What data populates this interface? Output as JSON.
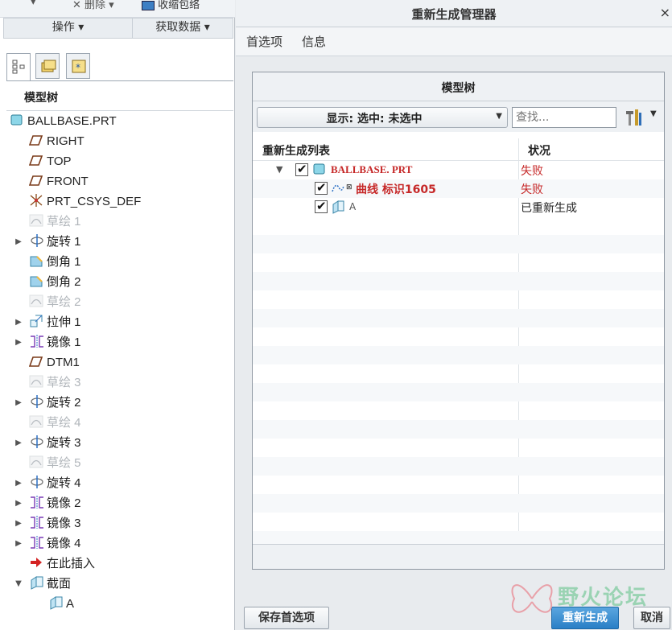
{
  "left_panel": {
    "ribbon_top": {
      "delete_label": "删除",
      "shrink_label": "收缩包络"
    },
    "groups": {
      "operations": "操作 ▾",
      "get_data": "获取数据 ▾"
    },
    "tabs": [
      "model-tree",
      "folder-browser",
      "favorites"
    ],
    "header": "模型树",
    "tree": [
      {
        "label": "BALLBASE.PRT",
        "icon": "part-icon",
        "dim": false,
        "expandable": false
      },
      {
        "label": "RIGHT",
        "icon": "datum-plane-icon",
        "dim": false,
        "expandable": false
      },
      {
        "label": "TOP",
        "icon": "datum-plane-icon",
        "dim": false,
        "expandable": false
      },
      {
        "label": "FRONT",
        "icon": "datum-plane-icon",
        "dim": false,
        "expandable": false
      },
      {
        "label": "PRT_CSYS_DEF",
        "icon": "csys-icon",
        "dim": false,
        "expandable": false
      },
      {
        "label": "草绘 1",
        "icon": "sketch-icon",
        "dim": true,
        "expandable": false
      },
      {
        "label": "旋转 1",
        "icon": "revolve-icon",
        "dim": false,
        "expandable": true
      },
      {
        "label": "倒角 1",
        "icon": "chamfer-icon",
        "dim": false,
        "expandable": false
      },
      {
        "label": "倒角 2",
        "icon": "chamfer-icon",
        "dim": false,
        "expandable": false
      },
      {
        "label": "草绘 2",
        "icon": "sketch-icon",
        "dim": true,
        "expandable": false
      },
      {
        "label": "拉伸 1",
        "icon": "extrude-icon",
        "dim": false,
        "expandable": true
      },
      {
        "label": "镜像 1",
        "icon": "mirror-icon",
        "dim": false,
        "expandable": true
      },
      {
        "label": "DTM1",
        "icon": "datum-plane-icon",
        "dim": false,
        "expandable": false
      },
      {
        "label": "草绘 3",
        "icon": "sketch-icon",
        "dim": true,
        "expandable": false
      },
      {
        "label": "旋转 2",
        "icon": "revolve-icon",
        "dim": false,
        "expandable": true
      },
      {
        "label": "草绘 4",
        "icon": "sketch-icon",
        "dim": true,
        "expandable": false
      },
      {
        "label": "旋转 3",
        "icon": "revolve-icon",
        "dim": false,
        "expandable": true
      },
      {
        "label": "草绘 5",
        "icon": "sketch-icon",
        "dim": true,
        "expandable": false
      },
      {
        "label": "旋转 4",
        "icon": "revolve-icon",
        "dim": false,
        "expandable": true
      },
      {
        "label": "镜像 2",
        "icon": "mirror-icon",
        "dim": false,
        "expandable": true
      },
      {
        "label": "镜像 3",
        "icon": "mirror-icon",
        "dim": false,
        "expandable": true
      },
      {
        "label": "镜像 4",
        "icon": "mirror-icon",
        "dim": false,
        "expandable": true
      },
      {
        "label": "在此插入",
        "icon": "insert-here-icon",
        "dim": false,
        "expandable": false
      },
      {
        "label": "截面",
        "icon": "section-icon",
        "dim": false,
        "expandable": true,
        "expanded": true
      },
      {
        "label": "A",
        "icon": "section-icon",
        "dim": false,
        "expandable": false
      }
    ]
  },
  "dialog": {
    "title": "重新生成管理器",
    "close": "×",
    "menu": {
      "preferences": "首选项",
      "info": "信息"
    },
    "model_tree": {
      "header": "模型树",
      "display_select": "显示: 选中: 未选中",
      "search_placeholder": "查找...",
      "columns": {
        "list": "重新生成列表",
        "status": "状况"
      },
      "rows": [
        {
          "label": "BALLBASE. PRT",
          "status": "失败",
          "status_color": "#c62828",
          "checked": true
        },
        {
          "label": "曲线 标识1605",
          "status": "失败",
          "status_color": "#c62828",
          "checked": true
        },
        {
          "label": "A",
          "status": "已重新生成",
          "status_color": "#222222",
          "checked": true
        }
      ]
    },
    "buttons": {
      "save_prefs": "保存首选项",
      "regenerate": "重新生成",
      "cancel": "取消"
    },
    "watermark": "野火论坛"
  },
  "colors": {
    "fail": "#c62828",
    "accent": "#1f7fc8"
  }
}
